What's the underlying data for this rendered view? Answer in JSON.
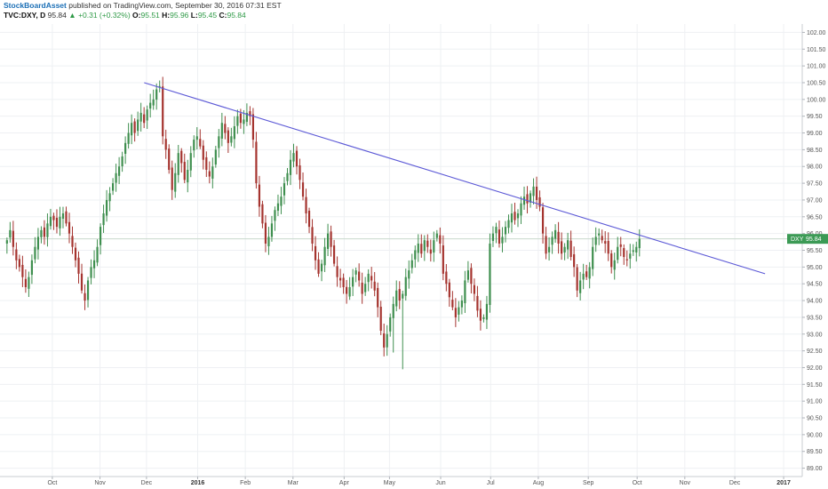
{
  "header": {
    "publisher": "StockBoardAsset",
    "published_text": "published on TradingView.com, September 30, 2016 07:31 EST",
    "symbol": "TVC:DXY, D",
    "last": "95.84",
    "change": "+0.31 (+0.32%)",
    "o_label": "O:",
    "o_value": "95.51",
    "h_label": "H:",
    "h_value": "95.96",
    "l_label": "L:",
    "l_value": "95.45",
    "c_label": "C:",
    "c_value": "95.84"
  },
  "price_label": {
    "symbol": "DXY",
    "value": "95.84"
  },
  "colors": {
    "up": "#3f8f4f",
    "down": "#a5342f",
    "trendline": "#5b58d6",
    "grid": "#eef0f3",
    "badge": "#3c9a55"
  },
  "chart_data": {
    "type": "candlestick",
    "title": "",
    "xlabel": "",
    "ylabel": "",
    "ylim": [
      88.75,
      102.25
    ],
    "y_ticks": [
      "102.00",
      "101.50",
      "101.00",
      "100.50",
      "100.00",
      "99.50",
      "99.00",
      "98.50",
      "98.00",
      "97.50",
      "97.00",
      "96.50",
      "96.00",
      "95.50",
      "95.00",
      "94.50",
      "94.00",
      "93.50",
      "93.00",
      "92.50",
      "92.00",
      "91.50",
      "91.00",
      "90.50",
      "90.00",
      "89.50",
      "89.00"
    ],
    "x_ticks": [
      {
        "label": "Oct",
        "t": -10.5,
        "bold": false
      },
      {
        "label": "Nov",
        "t": 10,
        "bold": false
      },
      {
        "label": "Dec",
        "t": 30,
        "bold": false
      },
      {
        "label": "2016",
        "t": 52,
        "bold": true
      },
      {
        "label": "Feb",
        "t": 72.5,
        "bold": false
      },
      {
        "label": "Mar",
        "t": 93,
        "bold": false
      },
      {
        "label": "Apr",
        "t": 115,
        "bold": false
      },
      {
        "label": "May",
        "t": 134.5,
        "bold": false
      },
      {
        "label": "Jun",
        "t": 156.5,
        "bold": false
      },
      {
        "label": "Jul",
        "t": 178,
        "bold": false
      },
      {
        "label": "Aug",
        "t": 198.5,
        "bold": false
      },
      {
        "label": "Sep",
        "t": 220,
        "bold": false
      },
      {
        "label": "Oct",
        "t": 241,
        "bold": false
      },
      {
        "label": "Nov",
        "t": 261.5,
        "bold": false
      },
      {
        "label": "Dec",
        "t": 283,
        "bold": false
      },
      {
        "label": "2017",
        "t": 304,
        "bold": true
      }
    ],
    "t_range": [
      -33,
      312
    ],
    "current_price": 95.84,
    "trendline": {
      "from": {
        "t": 29,
        "price": 100.5
      },
      "to": {
        "t": 296,
        "price": 94.8
      }
    },
    "closes": [
      95.8,
      96.1,
      95.6,
      95.2,
      95.0,
      94.7,
      94.4,
      94.7,
      95.2,
      95.6,
      95.9,
      96.1,
      95.9,
      96.3,
      96.5,
      96.4,
      96.2,
      96.5,
      96.6,
      96.3,
      96.0,
      95.6,
      95.2,
      94.8,
      94.3,
      94.0,
      94.6,
      95.0,
      95.2,
      95.6,
      96.2,
      96.6,
      97.0,
      97.2,
      97.5,
      97.8,
      98.0,
      98.3,
      98.7,
      99.0,
      99.3,
      99.0,
      99.4,
      99.6,
      99.3,
      99.7,
      99.9,
      100.0,
      100.3,
      100.4,
      98.9,
      98.5,
      97.9,
      97.3,
      97.8,
      98.4,
      98.1,
      97.6,
      97.9,
      98.4,
      98.8,
      98.9,
      98.6,
      98.2,
      97.9,
      97.7,
      98.0,
      98.5,
      98.9,
      99.3,
      99.0,
      98.7,
      98.9,
      99.2,
      99.5,
      99.3,
      99.4,
      99.6,
      99.5,
      98.8,
      97.5,
      96.8,
      96.3,
      95.7,
      95.9,
      96.3,
      96.7,
      96.9,
      97.1,
      97.5,
      97.8,
      98.2,
      98.4,
      98.0,
      97.6,
      97.1,
      96.6,
      96.2,
      95.7,
      95.2,
      94.8,
      95.1,
      95.6,
      96.0,
      95.6,
      95.1,
      94.7,
      94.6,
      94.4,
      94.2,
      94.4,
      94.7,
      94.9,
      94.6,
      94.2,
      94.5,
      94.8,
      94.6,
      94.3,
      93.8,
      93.1,
      92.6,
      93.0,
      93.5,
      93.9,
      94.3,
      94.0,
      94.2,
      94.7,
      94.9,
      95.2,
      95.5,
      95.7,
      95.4,
      95.8,
      95.6,
      95.4,
      95.8,
      96.0,
      95.7,
      94.8,
      94.5,
      94.1,
      93.8,
      93.5,
      93.8,
      94.0,
      94.6,
      94.9,
      94.5,
      94.2,
      93.7,
      93.4,
      93.5,
      93.9,
      95.7,
      96.0,
      96.2,
      95.7,
      95.9,
      96.2,
      96.4,
      96.6,
      96.4,
      96.6,
      96.9,
      97.1,
      96.9,
      97.2,
      97.4,
      97.0,
      96.8,
      96.0,
      95.4,
      95.6,
      95.9,
      96.1,
      95.7,
      95.4,
      95.6,
      95.8,
      95.3,
      95.0,
      94.3,
      94.6,
      94.8,
      94.7,
      95.0,
      95.6,
      95.9,
      96.0,
      95.8,
      95.7,
      95.4,
      95.0,
      95.2,
      95.6,
      95.6,
      95.3,
      95.2,
      95.4,
      95.5,
      95.6,
      95.84
    ]
  }
}
